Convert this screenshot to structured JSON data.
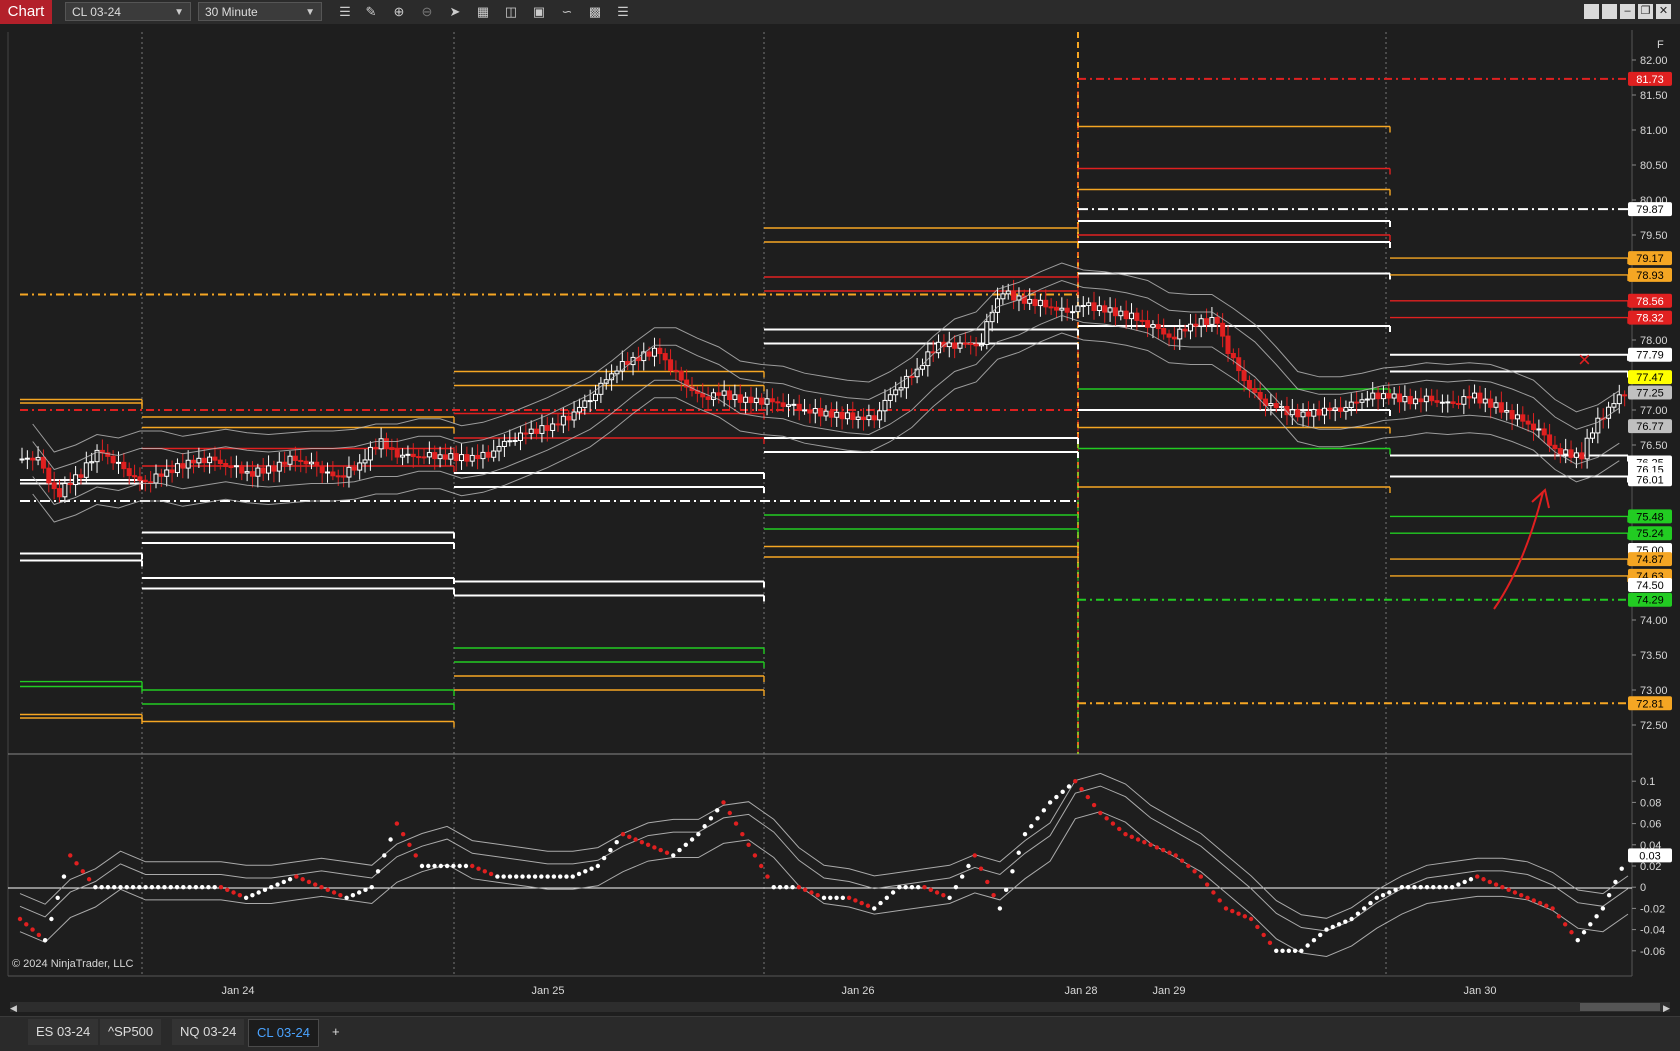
{
  "toolbar": {
    "chart_label": "Chart",
    "instrument": "CL 03-24",
    "timeframe": "30 Minute",
    "tools": [
      "bars-icon",
      "pencil-icon",
      "zoom-in-icon",
      "zoom-out-icon",
      "pointer-icon",
      "properties-icon",
      "data-box-icon",
      "indicators-icon",
      "strategies-icon",
      "drawing-tools-icon",
      "menu-list-icon"
    ],
    "window_buttons": [
      "tile-icon",
      "tile2-icon",
      "minimize-icon",
      "restore-icon",
      "maximize-icon",
      "close-icon"
    ]
  },
  "panel_marker": "F",
  "copyright": "© 2024 NinjaTrader, LLC",
  "colors": {
    "background": "#1e1e1e",
    "orange": "#f5a623",
    "red": "#e02020",
    "green": "#22cc22",
    "white": "#ffffff",
    "yellow": "#ffff00"
  },
  "chart_data": {
    "type": "candlestick",
    "price_axis": {
      "ylim": [
        72.2,
        82.4
      ],
      "ticks": [
        "82.00",
        "81.50",
        "81.00",
        "80.50",
        "80.00",
        "79.50",
        "78.00",
        "77.00",
        "76.50",
        "74.00",
        "73.50",
        "73.00",
        "72.50"
      ],
      "tags": [
        {
          "label": "81.73",
          "value": 81.73,
          "color": "#e02020"
        },
        {
          "label": "79.87",
          "value": 79.87,
          "color": "#ffffff"
        },
        {
          "label": "79.17",
          "value": 79.17,
          "color": "#f5a623"
        },
        {
          "label": "78.93",
          "value": 78.93,
          "color": "#f5a623"
        },
        {
          "label": "78.56",
          "value": 78.56,
          "color": "#e02020"
        },
        {
          "label": "78.32",
          "value": 78.32,
          "color": "#e02020"
        },
        {
          "label": "77.79",
          "value": 77.79,
          "color": "#ffffff"
        },
        {
          "label": "77.47",
          "value": 77.47,
          "color": "#ffff00"
        },
        {
          "label": "77.25",
          "value": 77.25,
          "color": "#c0c0c0"
        },
        {
          "label": "76.77",
          "value": 76.77,
          "color": "#c0c0c0"
        },
        {
          "label": "76.25",
          "value": 76.25,
          "color": "#ffffff"
        },
        {
          "label": "76.15",
          "value": 76.15,
          "color": "#ffffff"
        },
        {
          "label": "76.01",
          "value": 76.01,
          "color": "#ffffff"
        },
        {
          "label": "75.48",
          "value": 75.48,
          "color": "#22cc22"
        },
        {
          "label": "75.24",
          "value": 75.24,
          "color": "#22cc22"
        },
        {
          "label": "75.00",
          "value": 75.0,
          "color": "#ffffff"
        },
        {
          "label": "74.87",
          "value": 74.87,
          "color": "#f5a623"
        },
        {
          "label": "74.63",
          "value": 74.63,
          "color": "#f5a623"
        },
        {
          "label": "74.50",
          "value": 74.5,
          "color": "#ffffff"
        },
        {
          "label": "74.29",
          "value": 74.29,
          "color": "#22cc22"
        },
        {
          "label": "72.81",
          "value": 72.81,
          "color": "#f5a623"
        }
      ]
    },
    "indicator_axis": {
      "ylim": [
        -0.08,
        0.12
      ],
      "ticks": [
        "0.1",
        "0.08",
        "0.06",
        "0.04",
        "0.02",
        "0",
        "-0.02",
        "-0.04",
        "-0.06"
      ],
      "current": "0.03"
    },
    "time_axis": {
      "labels": [
        "Jan 24",
        "Jan 25",
        "Jan 26",
        "Jan 28",
        "Jan 29",
        "Jan 30"
      ]
    },
    "close_series": [
      76.3,
      75.5,
      76.2,
      76.6,
      76.1,
      75.9,
      76.2,
      76.3,
      76.3,
      76.1,
      76.0,
      76.2,
      76.4,
      76.2,
      76.0,
      76.3,
      76.7,
      76.2,
      76.3,
      76.3,
      76.3,
      76.4,
      76.7,
      76.8,
      76.8,
      77.0,
      77.3,
      77.7,
      77.8,
      77.9,
      77.3,
      77.1,
      77.3,
      77.1,
      77.1,
      77.0,
      76.9,
      76.9,
      76.9,
      76.9,
      77.5,
      77.7,
      78.1,
      77.9,
      77.9,
      79.0,
      78.5,
      78.5,
      78.4,
      78.6,
      78.4,
      78.3,
      78.1,
      77.9,
      78.3,
      78.3,
      77.3,
      77.0,
      77.0,
      76.9,
      77.0,
      77.0,
      77.2,
      77.2,
      77.1,
      77.2,
      77.1,
      77.3,
      77.0,
      76.8,
      76.6,
      76.2,
      76.3,
      77.2,
      77.4
    ],
    "indicator_series": [
      -0.03,
      -0.05,
      0.03,
      0.0,
      0.0,
      0.0,
      0.0,
      0.0,
      0.0,
      -0.01,
      0.0,
      0.01,
      0.0,
      -0.01,
      0.0,
      0.06,
      0.02,
      0.02,
      0.02,
      0.01,
      0.01,
      0.01,
      0.01,
      0.02,
      0.05,
      0.04,
      0.03,
      0.05,
      0.08,
      0.04,
      0.0,
      0.0,
      -0.01,
      -0.01,
      -0.02,
      0.0,
      0.0,
      -0.01,
      0.03,
      -0.02,
      0.05,
      0.08,
      0.1,
      0.07,
      0.05,
      0.04,
      0.03,
      0.01,
      -0.02,
      -0.03,
      -0.06,
      -0.06,
      -0.04,
      -0.03,
      -0.01,
      0.0,
      0.0,
      0.0,
      0.01,
      0.0,
      -0.01,
      -0.02,
      -0.05,
      -0.02,
      0.03
    ]
  },
  "tabs": [
    "ES 03-24",
    "^SP500",
    "NQ 03-24",
    "CL 03-24"
  ],
  "tabs_active": "CL 03-24",
  "add_tab": "+"
}
